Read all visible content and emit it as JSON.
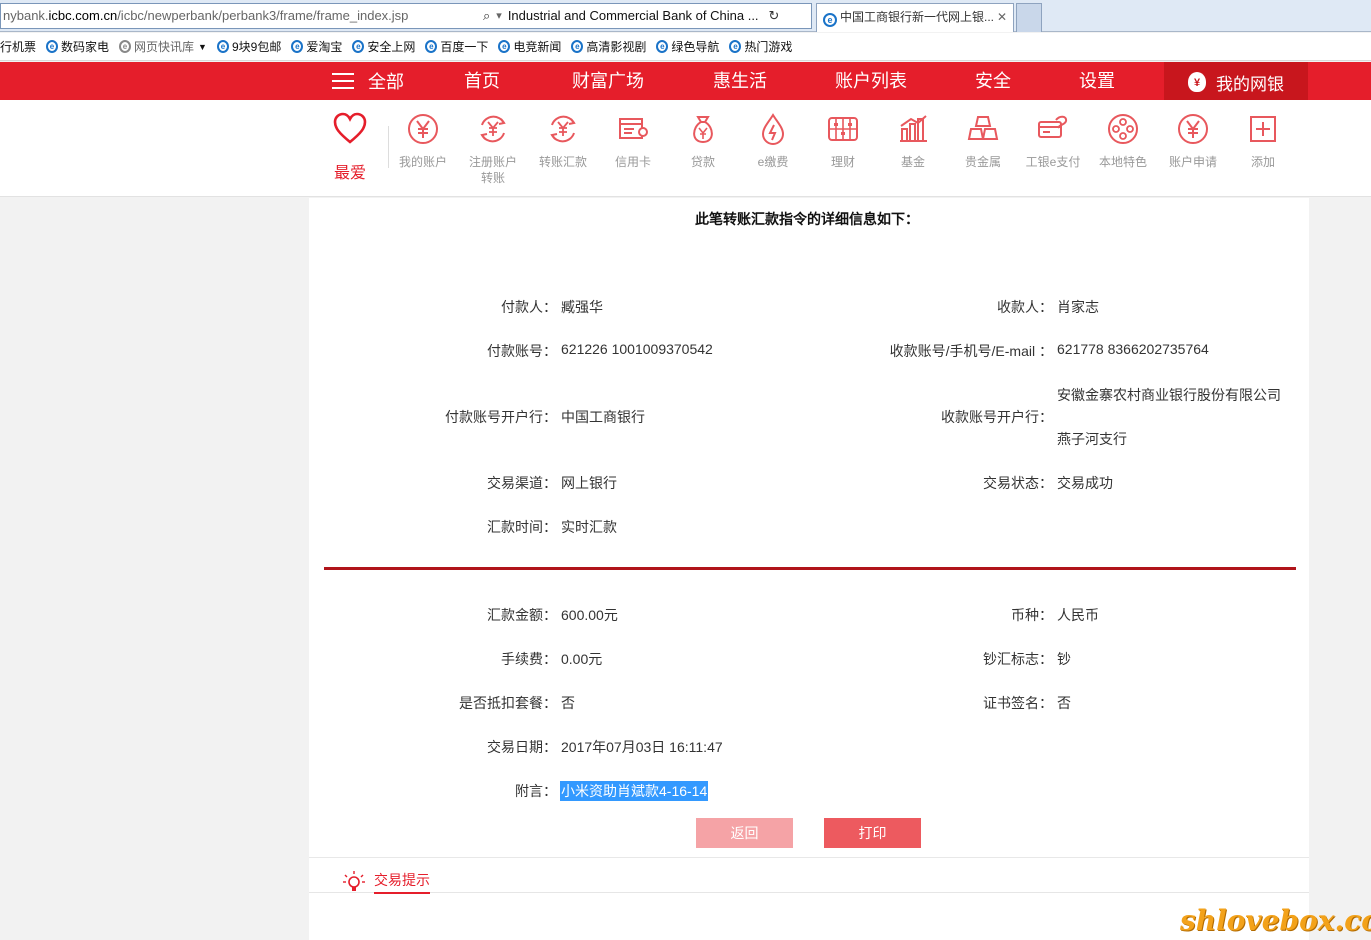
{
  "browser": {
    "url_prefix": "nybank.",
    "url_host": "icbc.com.cn",
    "url_path": "/icbc/newperbank/perbank3/frame/frame_index.jsp",
    "page_title_in_bar": "Industrial and Commercial Bank of China ...",
    "tab_title": "中国工商银行新一代网上银...",
    "favorites": [
      {
        "label": "行机票",
        "icon": "none"
      },
      {
        "label": "数码家电",
        "icon": "ie-icon"
      },
      {
        "label": "网页快讯库",
        "icon": "ie-grey-icon",
        "dropdown": true
      },
      {
        "label": "9块9包邮",
        "icon": "ie-icon"
      },
      {
        "label": "爱淘宝",
        "icon": "ie-icon"
      },
      {
        "label": "安全上网",
        "icon": "ie-icon"
      },
      {
        "label": "百度一下",
        "icon": "ie-icon"
      },
      {
        "label": "电竞新闻",
        "icon": "ie-icon"
      },
      {
        "label": "高清影视剧",
        "icon": "ie-icon"
      },
      {
        "label": "绿色导航",
        "icon": "ie-icon"
      },
      {
        "label": "热门游戏",
        "icon": "ie-icon"
      }
    ]
  },
  "nav": {
    "all": "全部",
    "items": [
      "首页",
      "财富广场",
      "惠生活",
      "账户列表",
      "安全",
      "设置"
    ],
    "mybank": "我的网银"
  },
  "quick": {
    "favorite_label": "最爱",
    "items": [
      {
        "label": "我的账户",
        "icon": "yen-circle-icon"
      },
      {
        "label": "注册账户转账",
        "icon": "yen-transfer-icon"
      },
      {
        "label": "转账汇款",
        "icon": "yen-transfer-icon"
      },
      {
        "label": "信用卡",
        "icon": "credit-card-icon"
      },
      {
        "label": "贷款",
        "icon": "money-bag-icon"
      },
      {
        "label": "e缴费",
        "icon": "lightning-drop-icon"
      },
      {
        "label": "理财",
        "icon": "abacus-icon"
      },
      {
        "label": "基金",
        "icon": "bar-chart-icon"
      },
      {
        "label": "贵金属",
        "icon": "gold-bars-icon"
      },
      {
        "label": "工银e支付",
        "icon": "card-pay-icon"
      },
      {
        "label": "本地特色",
        "icon": "film-reel-icon"
      },
      {
        "label": "账户申请",
        "icon": "yen-circle-icon"
      },
      {
        "label": "添加",
        "icon": "plus-square-icon"
      }
    ]
  },
  "detail": {
    "title": "此笔转账汇款指令的详细信息如下：",
    "payer_label": "付款人：",
    "payer": "臧强华",
    "payee_label": "收款人：",
    "payee": "肖家志",
    "payer_account_label": "付款账号：",
    "payer_account": "621226 1001009370542",
    "payee_account_label": "收款账号/手机号/E-mail ：",
    "payee_account": "621778 8366202735764",
    "payer_bank_label": "付款账号开户行：",
    "payer_bank": "中国工商银行",
    "payee_bank_label": "收款账号开户行：",
    "payee_bank_line1": "安徽金寨农村商业银行股份有限公司",
    "payee_bank_line2": "燕子河支行",
    "channel_label": "交易渠道：",
    "channel": "网上银行",
    "status_label": "交易状态：",
    "status": "交易成功",
    "time_label": "汇款时间：",
    "time": "实时汇款",
    "amount_label": "汇款金额：",
    "amount": "600.00元",
    "currency_label": "币种：",
    "currency": "人民币",
    "fee_label": "手续费：",
    "fee": "0.00元",
    "cash_label": "钞汇标志：",
    "cash": "钞",
    "package_label": "是否抵扣套餐：",
    "package": "否",
    "cert_label": "证书签名：",
    "cert": "否",
    "date_label": "交易日期：",
    "date": "2017年07月03日 16:11:47",
    "memo_label": "附言：",
    "memo": "小米资助肖斌款4-16-14"
  },
  "buttons": {
    "back": "返回",
    "print": "打印"
  },
  "tips": {
    "label": "交易提示"
  },
  "watermark": "shlovebox.com",
  "colors": {
    "brand_red": "#e51e2b",
    "dark_red": "#c8161d",
    "selection_blue": "#3399ff"
  }
}
